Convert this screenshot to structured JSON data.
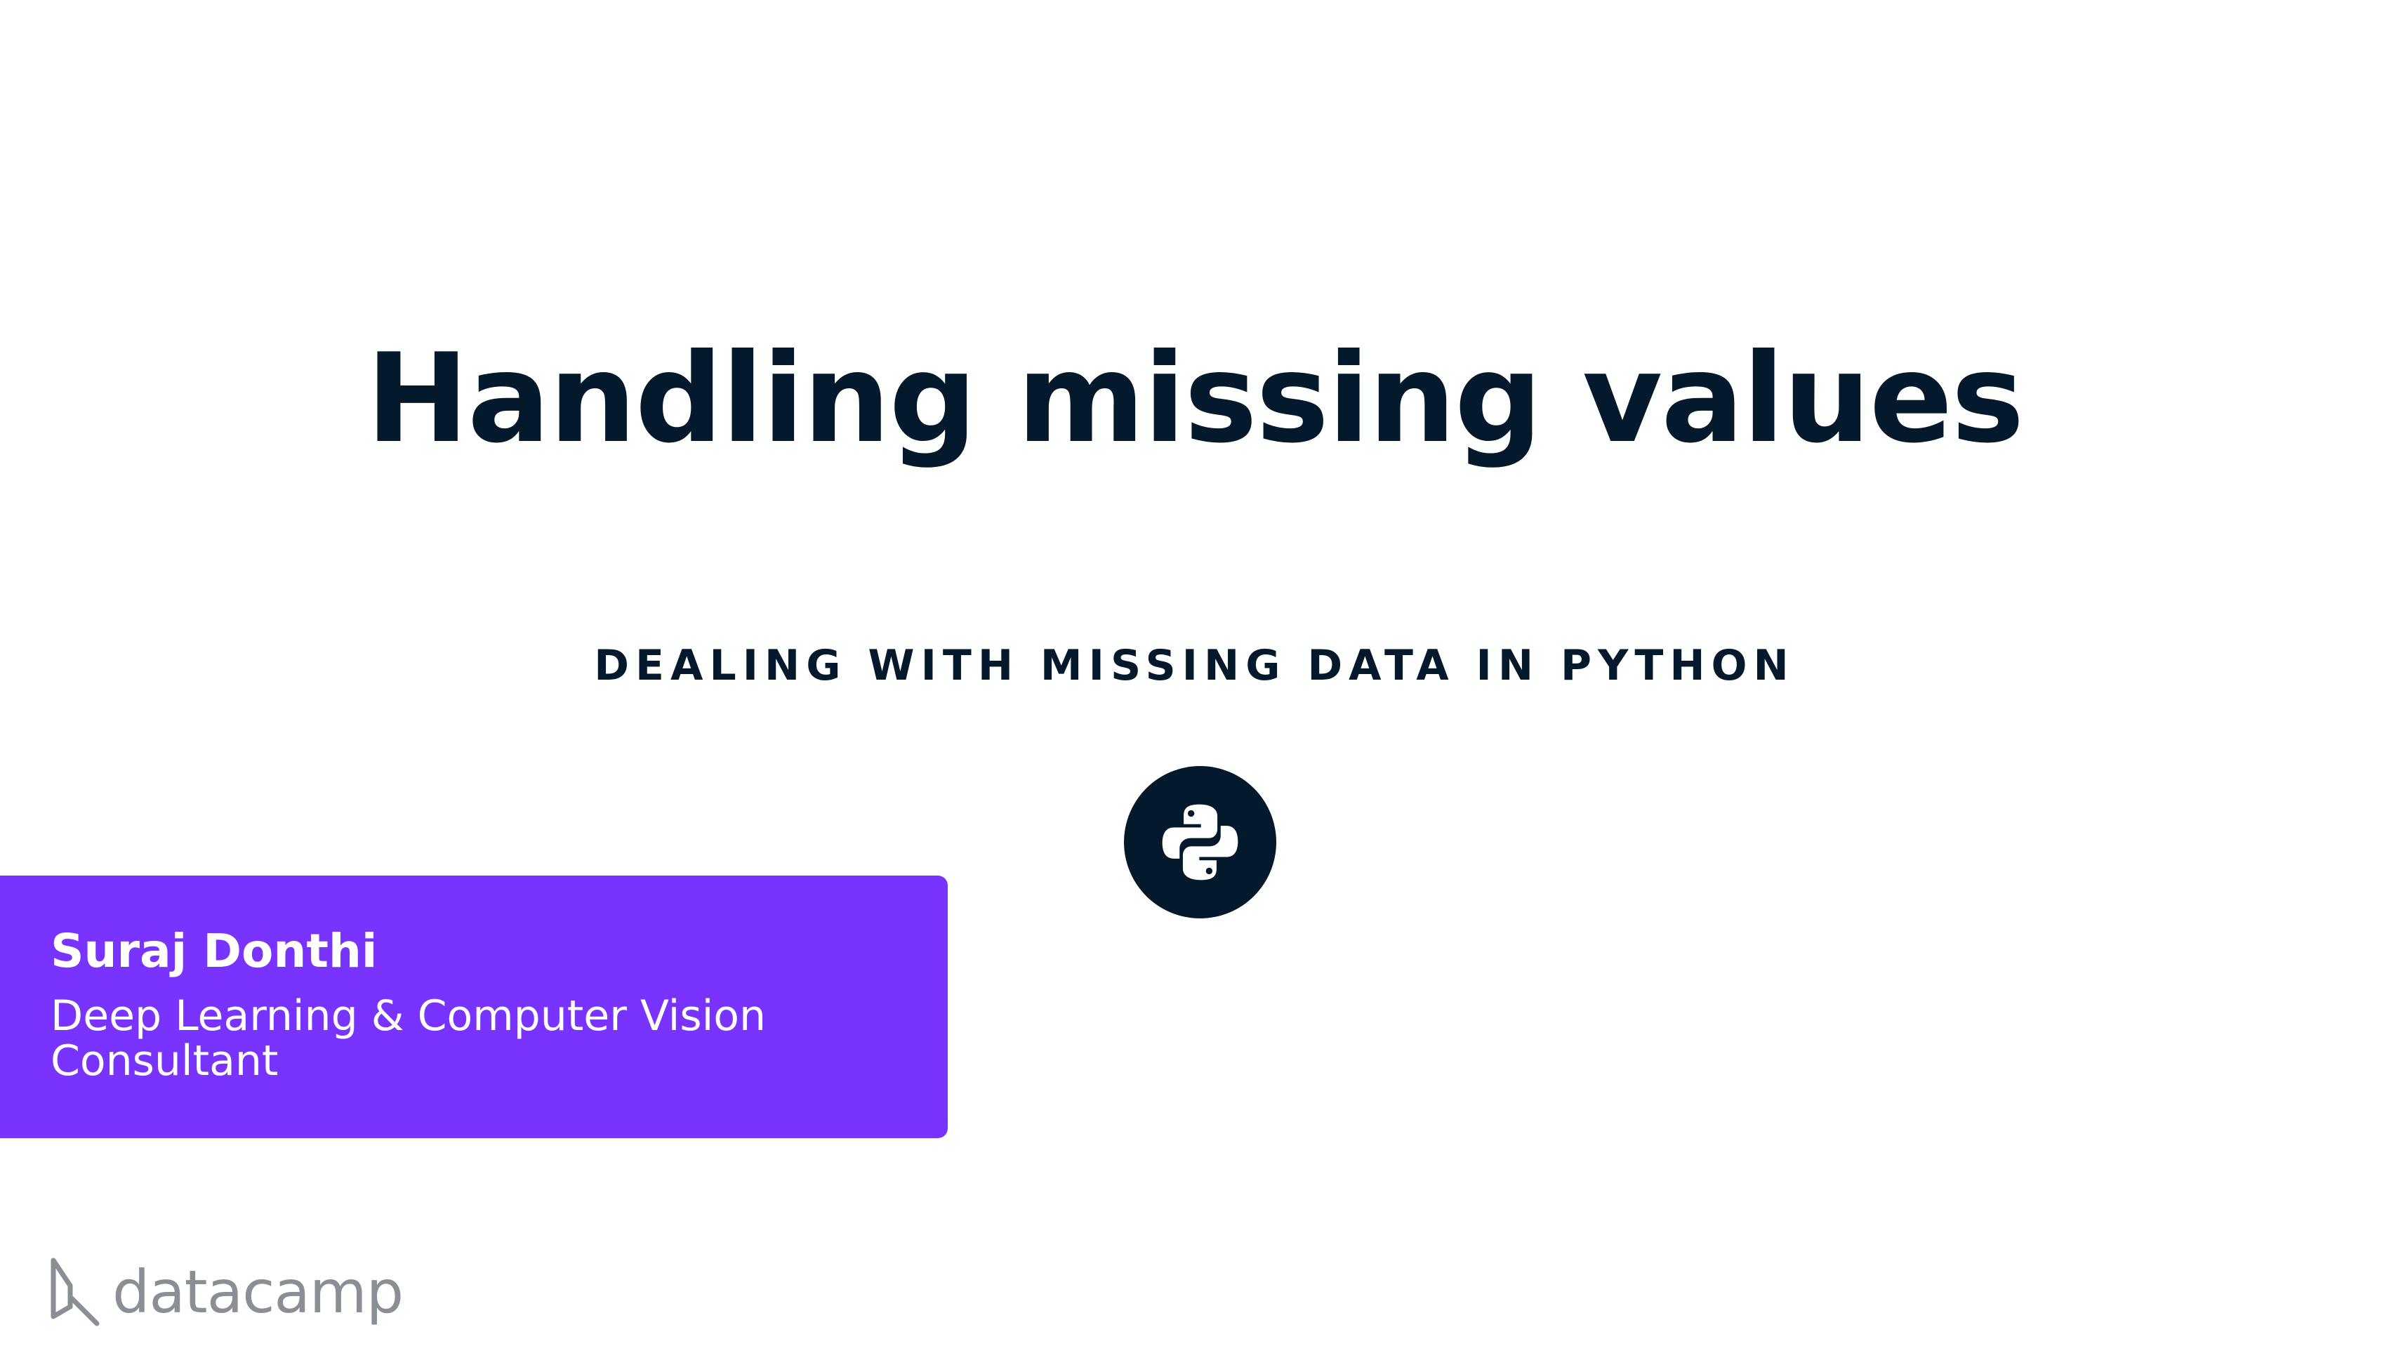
{
  "slide": {
    "title": "Handling missing values",
    "subtitle": "DEALING WITH MISSING DATA IN PYTHON",
    "icon": "python-icon"
  },
  "presenter": {
    "name": "Suraj Donthi",
    "role": "Deep Learning & Computer Vision Consultant"
  },
  "brand": {
    "name": "datacamp",
    "icon": "datacamp-logo-icon"
  },
  "colors": {
    "text_dark": "#05192d",
    "accent_purple": "#7933ff",
    "brand_gray": "#8a8f95",
    "background": "#ffffff"
  }
}
